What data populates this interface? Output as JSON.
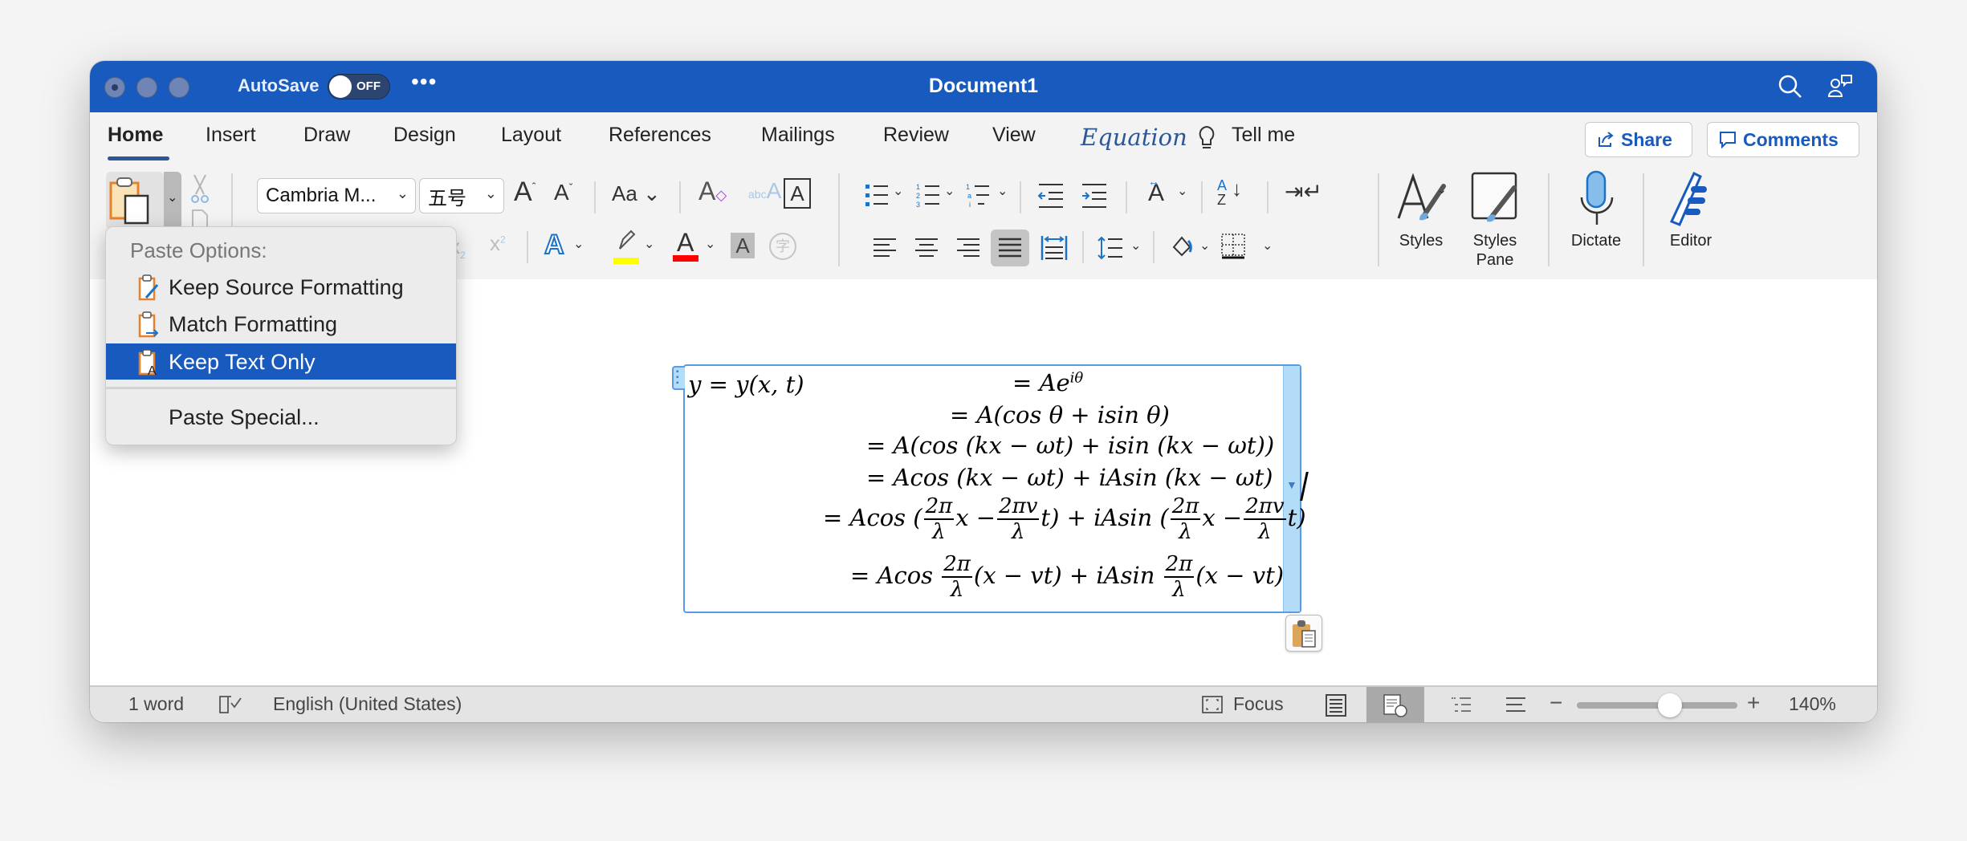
{
  "window": {
    "title": "Document1",
    "autosave_label": "AutoSave",
    "autosave_state": "OFF",
    "more_label": "•••"
  },
  "tabs": [
    {
      "label": "Home",
      "active": true
    },
    {
      "label": "Insert"
    },
    {
      "label": "Draw"
    },
    {
      "label": "Design"
    },
    {
      "label": "Layout"
    },
    {
      "label": "References"
    },
    {
      "label": "Mailings"
    },
    {
      "label": "Review"
    },
    {
      "label": "View"
    },
    {
      "label": "Equation",
      "contextual": true
    },
    {
      "label": "Tell me"
    }
  ],
  "header_buttons": {
    "share": "Share",
    "comments": "Comments"
  },
  "ribbon": {
    "font_name": "Cambria M...",
    "font_size": "五号",
    "change_case": "Aa",
    "styles_label": "Styles",
    "styles_pane_label": "Styles Pane",
    "dictate_label": "Dictate",
    "editor_label": "Editor",
    "highlight_color": "#ffff00",
    "font_color": "#ff0000"
  },
  "paste_menu": {
    "header": "Paste Options:",
    "items": [
      {
        "label": "Keep Source Formatting",
        "icon": "paste-keep-source-icon"
      },
      {
        "label": "Match Formatting",
        "icon": "paste-match-formatting-icon"
      },
      {
        "label": "Keep Text Only",
        "icon": "paste-text-only-icon",
        "selected": true
      }
    ],
    "special": "Paste Special..."
  },
  "equation": {
    "lhs": "y = y(x, t)",
    "lines": [
      "= Ae^{iθ}",
      "= A(cos θ + isin θ)",
      "= A(cos (kx − ωt) + isin (kx − ωt))",
      "= Acos (kx − ωt) + iAsin (kx − ωt)",
      "= Acos (2π/λ x − 2πv/λ t) + iAsin (2π/λ x − 2πv/λ t)",
      "= Acos 2π/λ (x − vt) + iAsin 2π/λ (x − vt)"
    ],
    "l1_a": "= A",
    "l1_e": "e",
    "l1_sup": "iθ",
    "l2": "= A(cos θ + isin θ)",
    "l3": "= A(cos (kx − ωt) + isin (kx − ωt))",
    "l4": "= Acos (kx − ωt) + iAsin (kx − ωt)",
    "l5_a": "= Acos (",
    "f_2pi": "2π",
    "f_lambda": "λ",
    "f_2piv": "2πv",
    "l5_x": "x −",
    "l5_t": "t) + iAsin (",
    "l5_x2": "x −",
    "l5_end": "t)",
    "l6_a": "= Acos",
    "l6_b": "(x − vt) + iAsin",
    "l6_c": "(x − vt)"
  },
  "statusbar": {
    "word_count": "1 word",
    "language": "English (United States)",
    "focus": "Focus",
    "zoom": "140%",
    "zoom_slider_fraction": 0.58
  }
}
